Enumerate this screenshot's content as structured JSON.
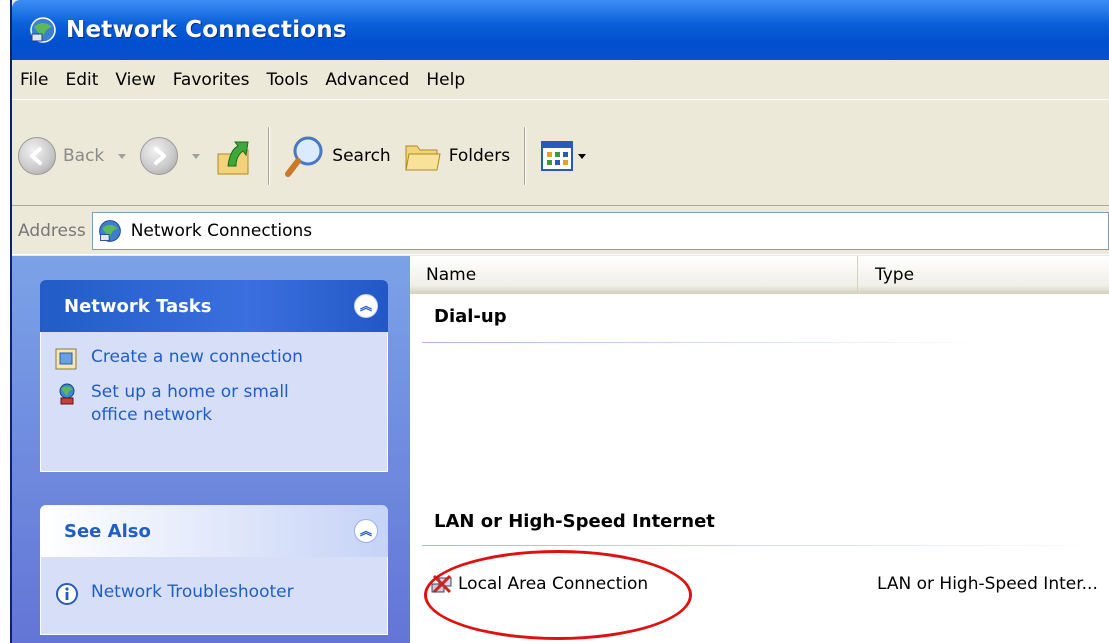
{
  "window": {
    "title": "Network Connections"
  },
  "menu": [
    "File",
    "Edit",
    "View",
    "Favorites",
    "Tools",
    "Advanced",
    "Help"
  ],
  "toolbar": {
    "back_label": "Back",
    "search_label": "Search",
    "folders_label": "Folders"
  },
  "address": {
    "label": "Address",
    "value": "Network Connections"
  },
  "task_panels": {
    "network_tasks": {
      "title": "Network Tasks",
      "items": [
        "Create a new connection",
        "Set up a home or small\noffice network"
      ]
    },
    "see_also": {
      "title": "See Also",
      "items": [
        "Network Troubleshooter"
      ]
    }
  },
  "list": {
    "columns": [
      "Name",
      "Type"
    ],
    "groups": [
      {
        "name": "Dial-up",
        "items": []
      },
      {
        "name": "LAN or High-Speed Internet",
        "items": [
          {
            "name": "Local Area Connection",
            "type": "LAN or High-Speed Inter..."
          }
        ]
      }
    ]
  },
  "icons": {
    "window": "network-connections-icon",
    "up": "up-folder-icon",
    "search": "magnifier-icon",
    "folders": "folders-icon",
    "views": "views-icon",
    "task1": "new-connection-icon",
    "task2": "home-network-icon",
    "troubleshooter": "info-icon",
    "lan": "lan-connection-icon"
  },
  "colors": {
    "titlebar": "#0a5fd8",
    "task_link": "#215dc6",
    "highlight": "#e01010"
  }
}
